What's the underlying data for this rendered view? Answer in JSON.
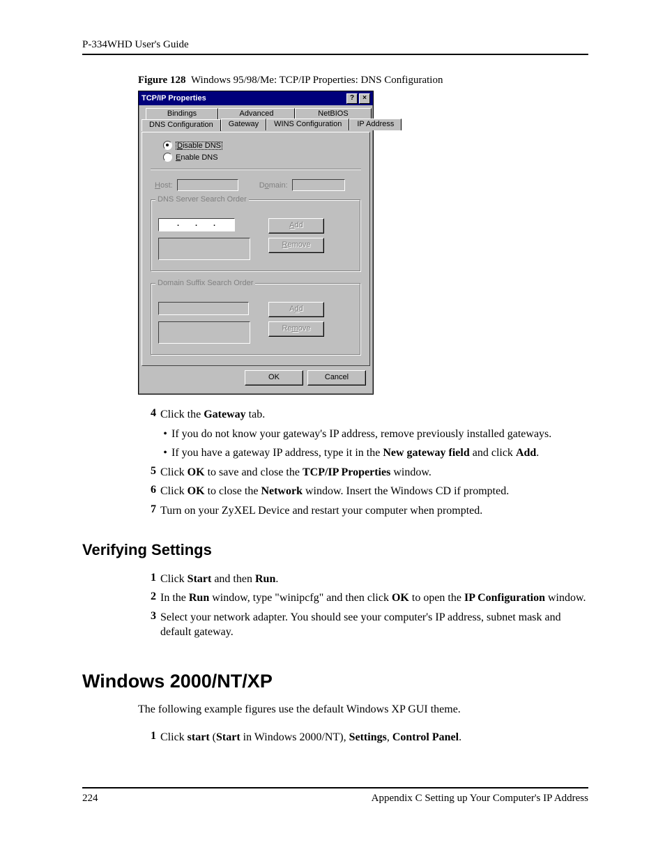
{
  "header": {
    "guide": "P-334WHD User's Guide"
  },
  "figure": {
    "label": "Figure 128",
    "caption": "Windows 95/98/Me: TCP/IP Properties: DNS Configuration"
  },
  "dialog": {
    "title": "TCP/IP Properties",
    "help_btn": "?",
    "close_btn": "×",
    "tabs_back": [
      "Bindings",
      "Advanced",
      "NetBIOS"
    ],
    "tabs_front": [
      "DNS Configuration",
      "Gateway",
      "WINS Configuration",
      "IP Address"
    ],
    "radio_disable": "Disable DNS",
    "radio_enable": "Enable DNS",
    "host_label": "Host:",
    "domain_label": "Domain:",
    "group1": "DNS Server Search Order",
    "group2": "Domain Suffix Search Order",
    "add": "Add",
    "remove": "Remove",
    "ok": "OK",
    "cancel": "Cancel"
  },
  "steps1": {
    "s4_num": "4",
    "s4_a": "Click the ",
    "s4_b": "Gateway",
    "s4_c": " tab.",
    "sub1": "If you do not know your gateway's IP address, remove previously installed gateways.",
    "sub2_a": "If you have a gateway IP address, type it in the ",
    "sub2_b": "New gateway field",
    "sub2_c": " and click ",
    "sub2_d": "Add",
    "sub2_e": ".",
    "s5_num": "5",
    "s5_a": "Click ",
    "s5_b": "OK",
    "s5_c": " to save and close the ",
    "s5_d": "TCP/IP Properties",
    "s5_e": " window.",
    "s6_num": "6",
    "s6_a": "Click ",
    "s6_b": "OK",
    "s6_c": " to close the ",
    "s6_d": "Network",
    "s6_e": " window. Insert the Windows CD if prompted.",
    "s7_num": "7",
    "s7": "Turn on your ZyXEL Device and restart your computer when prompted."
  },
  "h2": "Verifying Settings",
  "steps2": {
    "s1_num": "1",
    "s1_a": "Click ",
    "s1_b": "Start",
    "s1_c": " and then ",
    "s1_d": "Run",
    "s1_e": ".",
    "s2_num": "2",
    "s2_a": "In the ",
    "s2_b": "Run",
    "s2_c": " window, type \"winipcfg\" and then click ",
    "s2_d": "OK",
    "s2_e": " to open the ",
    "s2_f": "IP Configuration",
    "s2_g": " window.",
    "s3_num": "3",
    "s3": "Select your network adapter. You should see your computer's IP address, subnet mask and default gateway."
  },
  "h1": "Windows 2000/NT/XP",
  "para1": "The following example figures use the default Windows XP GUI theme.",
  "steps3": {
    "s1_num": "1",
    "s1_a": "Click ",
    "s1_b": "start",
    "s1_c": " (",
    "s1_d": "Start",
    "s1_e": " in Windows 2000/NT), ",
    "s1_f": "Settings",
    "s1_g": ", ",
    "s1_h": "Control Panel",
    "s1_i": "."
  },
  "footer": {
    "page": "224",
    "appendix": "Appendix C Setting up Your Computer's IP Address"
  }
}
